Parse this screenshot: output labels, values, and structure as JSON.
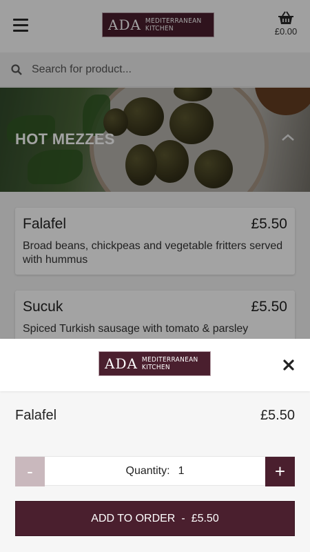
{
  "header": {
    "logo": {
      "mark": "ADA",
      "line1": "MEDITERRANEAN",
      "line2": "KITCHEN"
    },
    "basket_total": "£0.00"
  },
  "search": {
    "placeholder": "Search for product..."
  },
  "category": {
    "title": "HOT MEZZES"
  },
  "products": [
    {
      "name": "Falafel",
      "price": "£5.50",
      "description": "Broad beans, chickpeas and vegetable fritters served with hummus"
    },
    {
      "name": "Sucuk",
      "price": "£5.50",
      "description": "Spiced Turkish sausage with tomato & parsley"
    }
  ],
  "modal": {
    "logo": {
      "mark": "ADA",
      "line1": "MEDITERRANEAN",
      "line2": "KITCHEN"
    },
    "item_name": "Falafel",
    "item_price": "£5.50",
    "quantity_label": "Quantity:",
    "quantity_value": "1",
    "minus_label": "-",
    "plus_label": "+",
    "add_label": "ADD TO ORDER",
    "add_separator": "-",
    "add_price": "£5.50"
  },
  "colors": {
    "brand": "#4a1f2e",
    "minus_disabled": "#c9b8bd"
  },
  "icons": [
    "menu-icon",
    "basket-icon",
    "search-icon",
    "chevron-up-icon",
    "close-icon"
  ]
}
